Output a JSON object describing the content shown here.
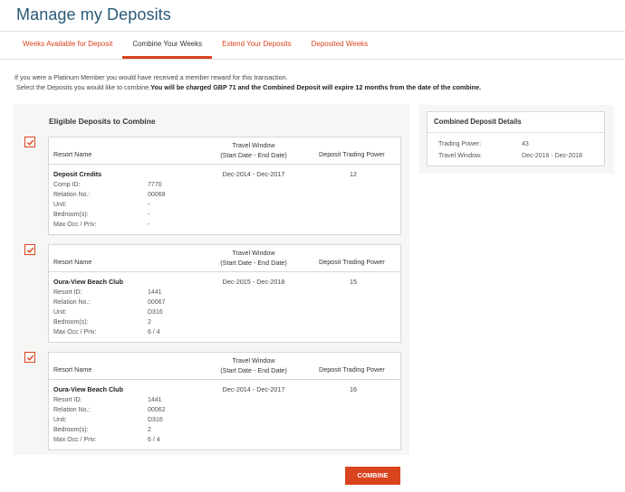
{
  "page": {
    "title": "Manage my Deposits"
  },
  "tabs": [
    {
      "label": "Weeks Available for Deposit",
      "active": false
    },
    {
      "label": "Combine Your Weeks",
      "active": true
    },
    {
      "label": "Extend Your Deposits",
      "active": false
    },
    {
      "label": "Deposited Weeks",
      "active": false
    }
  ],
  "intro": {
    "line1": "If you were a Platinum Member you would have received a member reward for this transaction.",
    "line2_prefix": "Select the Deposits you would like to combine.",
    "line2_bold": "You will be charged GBP 71 and the Combined Deposit will expire 12 months from the date of the combine."
  },
  "deposits": {
    "heading": "Eligible Deposits to Combine",
    "columns": {
      "resort": "Resort Name",
      "travel_line1": "Travel Window",
      "travel_line2": "(Start Date - End Date)",
      "power": "Deposit Trading Power"
    },
    "items": [
      {
        "checked": true,
        "name": "Deposit Credits",
        "id_label": "Comp ID:",
        "id_value": "7770",
        "relation_label": "Relation No.:",
        "relation_value": "00068",
        "unit_label": "Unit:",
        "unit_value": "-",
        "bedrooms_label": "Bedroom(s):",
        "bedrooms_value": "-",
        "occ_label": "Max Occ / Priv:",
        "occ_value": "-",
        "travel_window": "Dec-2014 - Dec-2017",
        "trading_power": "12"
      },
      {
        "checked": true,
        "name": "Oura-View Beach Club",
        "id_label": "Resort ID:",
        "id_value": "1441",
        "relation_label": "Relation No.:",
        "relation_value": "00067",
        "unit_label": "Unit:",
        "unit_value": "D316",
        "bedrooms_label": "Bedroom(s):",
        "bedrooms_value": "2",
        "occ_label": "Max Occ / Priv:",
        "occ_value": "6 / 4",
        "travel_window": "Dec-2015 - Dec-2018",
        "trading_power": "15"
      },
      {
        "checked": true,
        "name": "Oura-View Beach Club",
        "id_label": "Resort ID:",
        "id_value": "1441",
        "relation_label": "Relation No.:",
        "relation_value": "00062",
        "unit_label": "Unit:",
        "unit_value": "D316",
        "bedrooms_label": "Bedroom(s):",
        "bedrooms_value": "2",
        "occ_label": "Max Occ / Priv:",
        "occ_value": "6 / 4",
        "travel_window": "Dec-2014 - Dec-2017",
        "trading_power": "16"
      }
    ]
  },
  "summary": {
    "title": "Combined Deposit Details",
    "trading_power_label": "Trading Power:",
    "trading_power_value": "43",
    "travel_window_label": "Travel Window:",
    "travel_window_value": "Dec-2016 - Dec-2018"
  },
  "actions": {
    "combine_label": "COMBINE"
  },
  "colors": {
    "accent": "#d9441e",
    "title": "#2a5a78",
    "panel_bg": "#f6f6f4"
  },
  "icons": {
    "checkbox": "checkmark-icon"
  }
}
